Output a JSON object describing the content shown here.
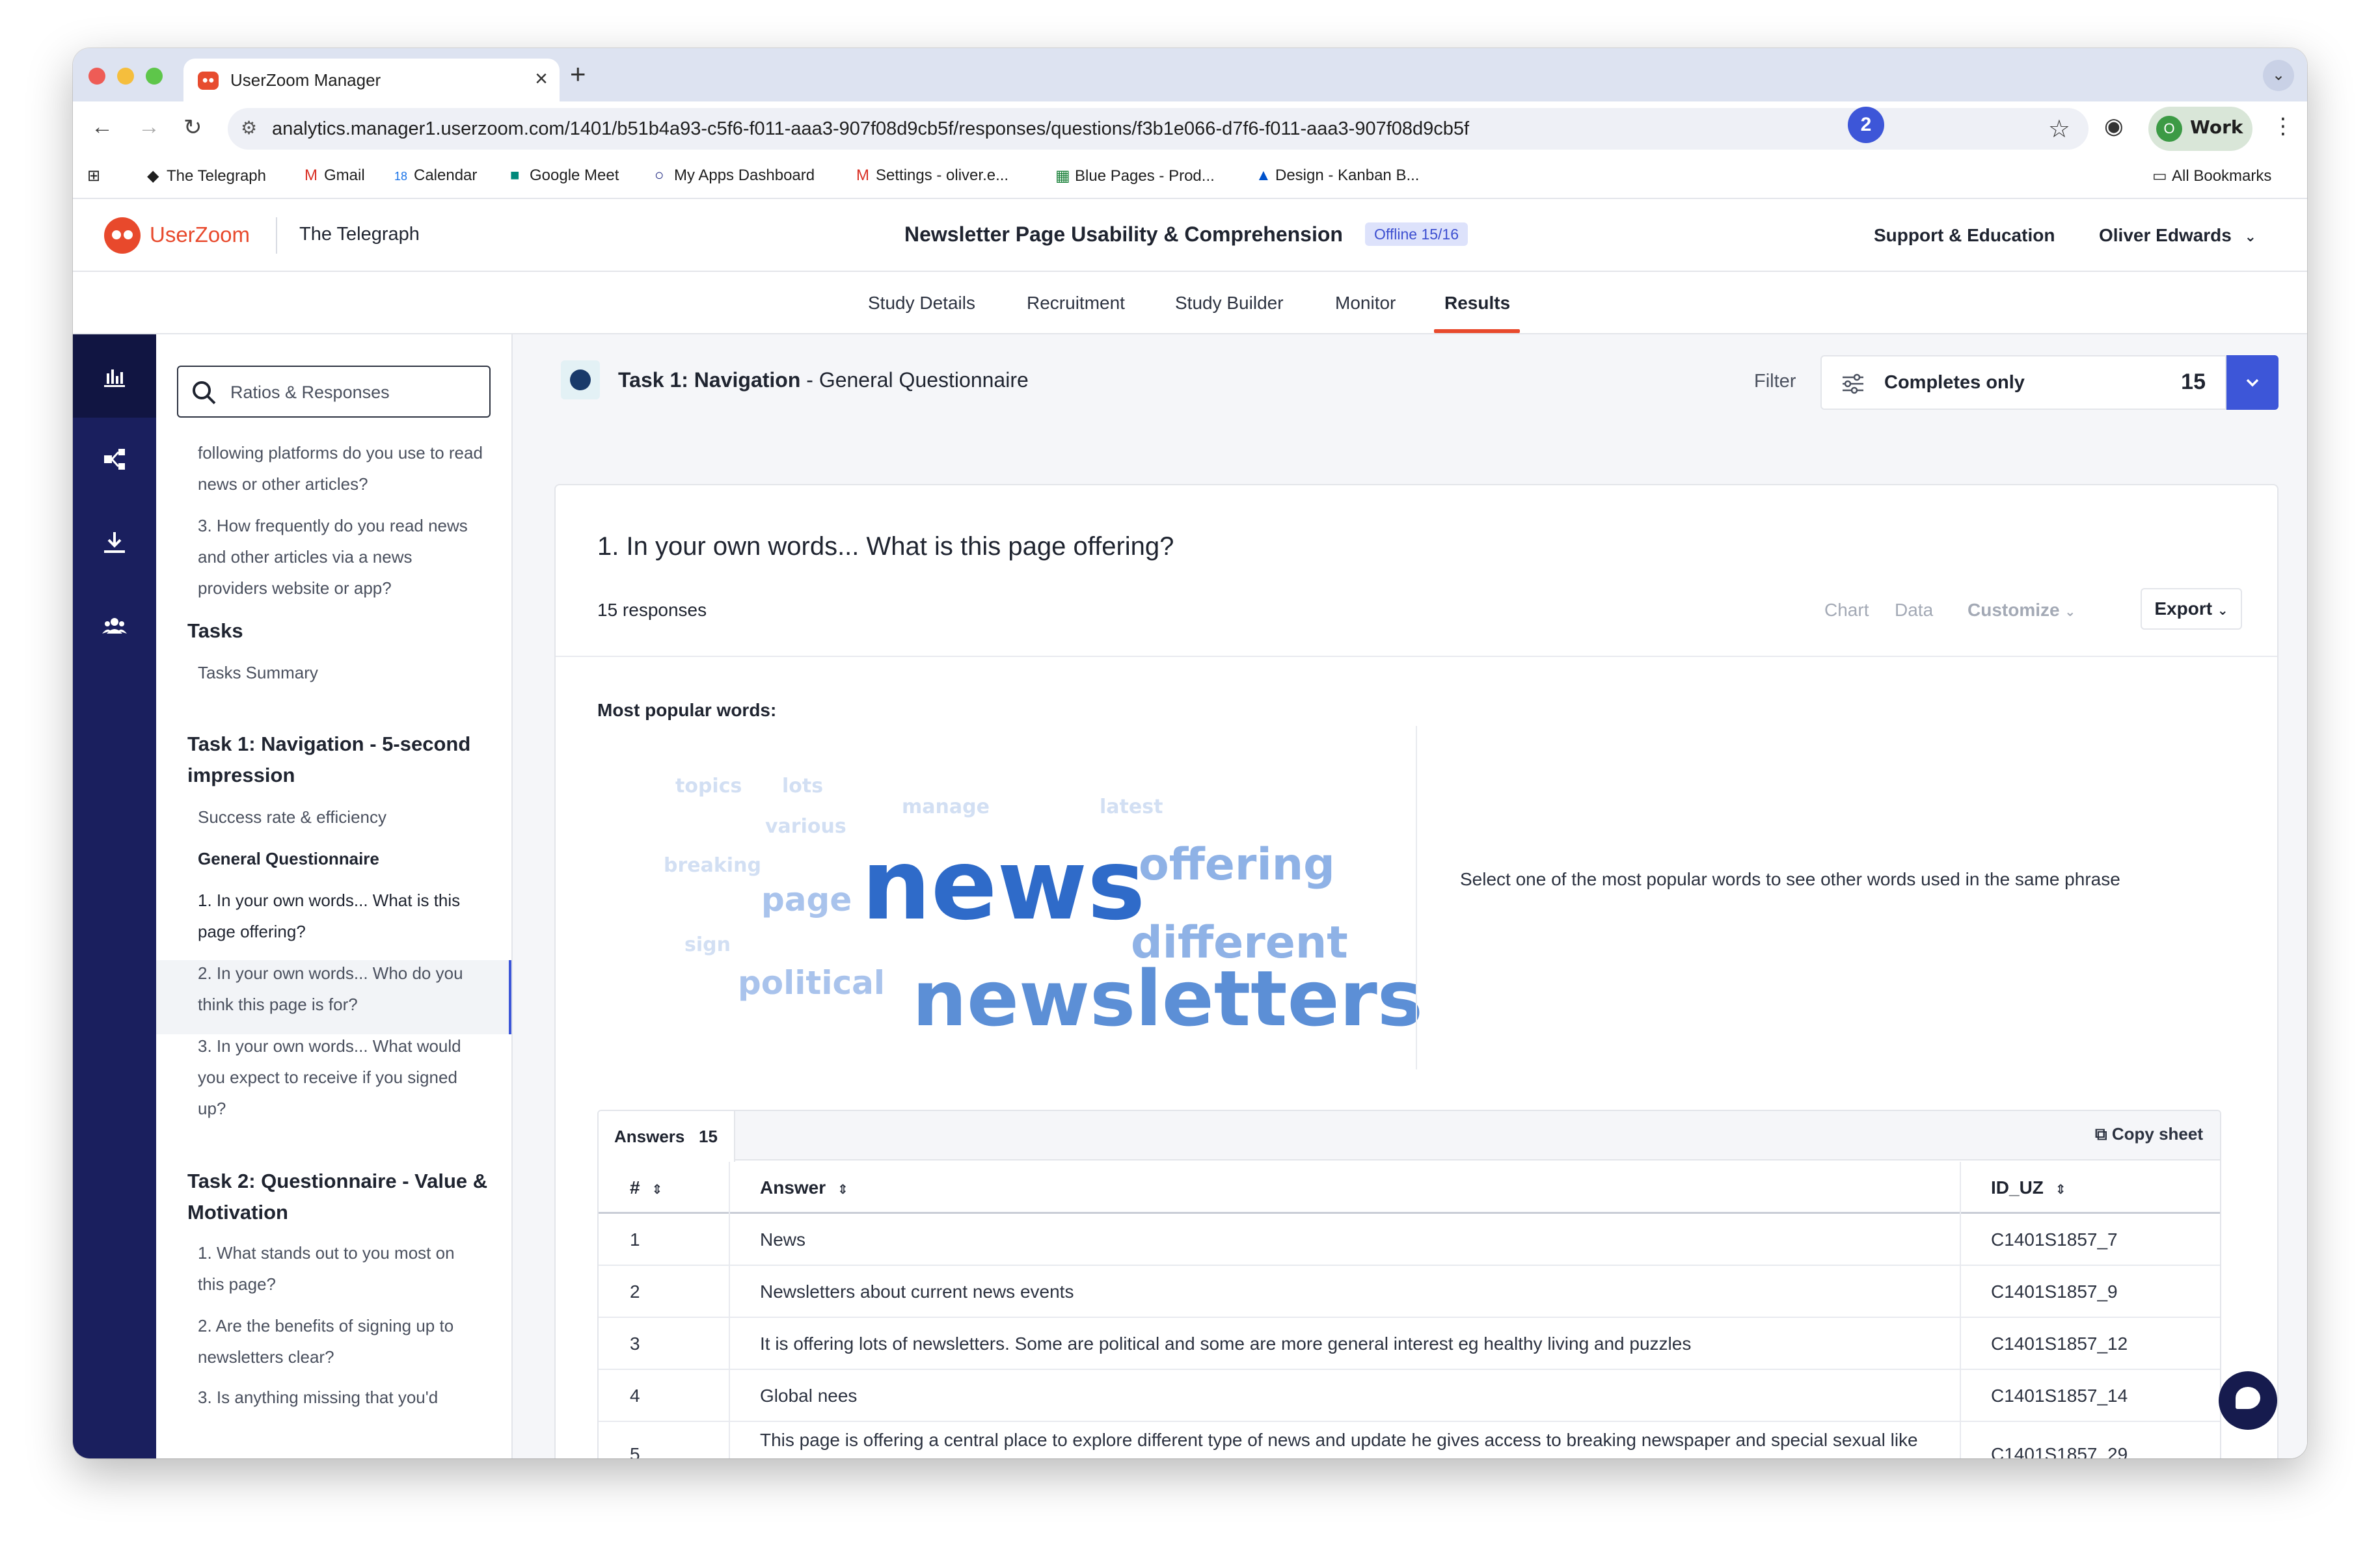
{
  "browser": {
    "tab_title": "UserZoom Manager",
    "url": "analytics.manager1.userzoom.com/1401/b51b4a93-c5f6-f011-aaa3-907f08d9cb5f/responses/questions/f3b1e066-d7f6-f011-aaa3-907f08d9cb5f",
    "profile_initial": "O",
    "profile_label": "Work",
    "bookmarks": [
      "The Telegraph",
      "Gmail",
      "Calendar",
      "Google Meet",
      "My Apps Dashboard",
      "Settings - oliver.e...",
      "Blue Pages - Prod...",
      "Design - Kanban B..."
    ],
    "all_bookmarks": "All Bookmarks",
    "calendar_day": "18"
  },
  "header": {
    "brand": "UserZoom",
    "client": "The Telegraph",
    "study_title": "Newsletter Page Usability & Comprehension",
    "status_badge": "Offline 15/16",
    "notification_count": "2",
    "support": "Support & Education",
    "user": "Oliver Edwards"
  },
  "topnav": [
    "Study Details",
    "Recruitment",
    "Study Builder",
    "Monitor",
    "Results"
  ],
  "sidebar": {
    "search_placeholder": "Ratios & Responses",
    "items": [
      "following platforms do you use to read news or other articles?",
      "3. How frequently do you read news and other articles via a news providers website or app?",
      "Tasks",
      "Tasks Summary",
      "Task 1: Navigation - 5-second impression",
      "Success rate & efficiency",
      "General Questionnaire",
      "1.  In your own words... What is this page offering?",
      "2.  In your own words... Who do you think this page is for?",
      "3. In your own words... What would you expect to receive if you signed up?",
      "Task 2: Questionnaire - Value & Motivation",
      "1. What stands out to you most on this page?",
      "2. Are the benefits of signing up to newsletters clear?",
      "3. Is anything missing that you'd"
    ]
  },
  "main": {
    "task_prefix": "Task 1: Navigation",
    "task_suffix": " - General Questionnaire",
    "filter_label": "Filter",
    "filter_value": "Completes only",
    "filter_count": "15",
    "question": "1.  In your own words... What is this page offering?",
    "responses": "15 responses",
    "controls": {
      "chart": "Chart",
      "data": "Data",
      "customize": "Customize",
      "export": "Export"
    },
    "popular_label": "Most popular words:",
    "cloud_hint": "Select one of the most popular words to see other words used in the same phrase",
    "cloud_words": [
      {
        "text": "news",
        "size": 1.0
      },
      {
        "text": "newsletters",
        "size": 0.8
      },
      {
        "text": "offering",
        "size": 0.5
      },
      {
        "text": "different",
        "size": 0.5
      },
      {
        "text": "page",
        "size": 0.4
      },
      {
        "text": "political",
        "size": 0.4
      },
      {
        "text": "topics",
        "size": 0.2
      },
      {
        "text": "lots",
        "size": 0.2
      },
      {
        "text": "manage",
        "size": 0.2
      },
      {
        "text": "latest",
        "size": 0.2
      },
      {
        "text": "various",
        "size": 0.2
      },
      {
        "text": "breaking",
        "size": 0.2
      },
      {
        "text": "sign",
        "size": 0.2
      }
    ],
    "table": {
      "tab_label": "Answers",
      "tab_count": "15",
      "copy_sheet": "Copy sheet",
      "headers": [
        "#",
        "Answer",
        "ID_UZ"
      ],
      "rows": [
        {
          "num": "1",
          "answer": "News",
          "id": "C1401S1857_7"
        },
        {
          "num": "2",
          "answer": "Newsletters about current news events",
          "id": "C1401S1857_9"
        },
        {
          "num": "3",
          "answer": "It is offering lots of newsletters. Some are political and some are more general interest eg healthy living and puzzles",
          "id": "C1401S1857_12"
        },
        {
          "num": "4",
          "answer": "Global nees",
          "id": "C1401S1857_14"
        },
        {
          "num": "5",
          "answer": "This page is offering a central place to explore different type of news and update he gives access to breaking newspaper and special sexual like political business health lifestyle culture and world news",
          "id": "C1401S1857_29"
        }
      ]
    }
  },
  "colors": {
    "accent": "#3d56d8",
    "brand": "#e8492c",
    "rail": "#1a1f5e"
  }
}
